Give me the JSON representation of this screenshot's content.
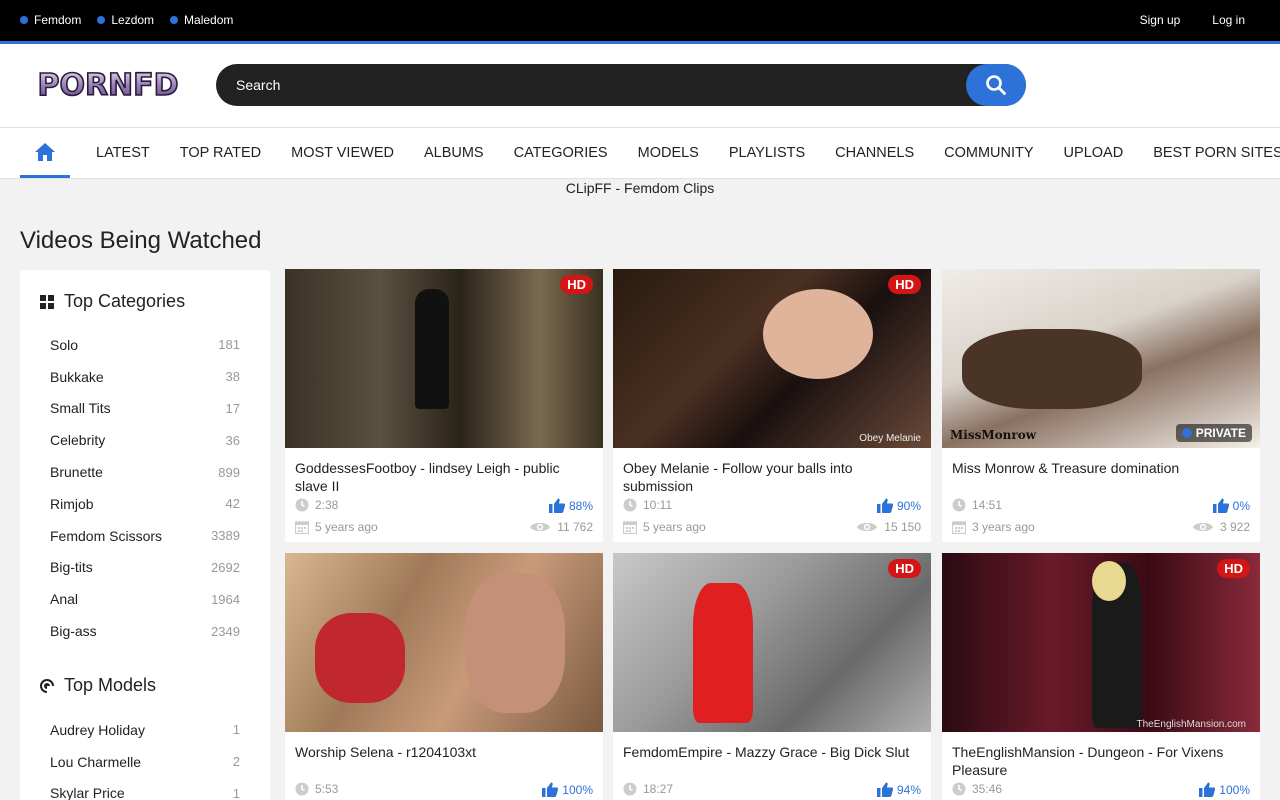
{
  "colors": {
    "accent": "#2d72d9",
    "hd_badge": "#d41515",
    "topbar": "#000000",
    "search_bg": "#222222"
  },
  "topbar": {
    "niches": [
      "Femdom",
      "Lezdom",
      "Maledom"
    ],
    "signup": "Sign up",
    "login": "Log in"
  },
  "header": {
    "logo_text": "PORNFD",
    "search_placeholder": "Search"
  },
  "nav": {
    "items": [
      "LATEST",
      "TOP RATED",
      "MOST VIEWED",
      "ALBUMS",
      "CATEGORIES",
      "MODELS",
      "PLAYLISTS",
      "CHANNELS",
      "COMMUNITY",
      "UPLOAD",
      "BEST PORN SITES"
    ]
  },
  "banner_text": "CLipFF - Femdom Clips",
  "page_title": "Videos Being Watched",
  "sidebar": {
    "categories_title": "Top Categories",
    "categories": [
      {
        "name": "Solo",
        "count": "181"
      },
      {
        "name": "Bukkake",
        "count": "38"
      },
      {
        "name": "Small Tits",
        "count": "17"
      },
      {
        "name": "Celebrity",
        "count": "36"
      },
      {
        "name": "Brunette",
        "count": "899"
      },
      {
        "name": "Rimjob",
        "count": "42"
      },
      {
        "name": "Femdom Scissors",
        "count": "3389"
      },
      {
        "name": "Big-tits",
        "count": "2692"
      },
      {
        "name": "Anal",
        "count": "1964"
      },
      {
        "name": "Big-ass",
        "count": "2349"
      }
    ],
    "models_title": "Top Models",
    "models": [
      {
        "name": "Audrey Holiday",
        "count": "1"
      },
      {
        "name": "Lou Charmelle",
        "count": "2"
      },
      {
        "name": "Skylar Price",
        "count": "1"
      }
    ]
  },
  "videos": [
    {
      "title": "GoddessesFootboy - lindsey Leigh - public slave II",
      "duration": "2:38",
      "rating": "88%",
      "age": "5 years ago",
      "views": "11 762",
      "badge": "HD"
    },
    {
      "title": "Obey Melanie - Follow your balls into submission",
      "duration": "10:11",
      "rating": "90%",
      "age": "5 years ago",
      "views": "15 150",
      "badge": "HD",
      "watermark": "Obey Melanie"
    },
    {
      "title": "Miss Monrow & Treasure domination",
      "duration": "14:51",
      "rating": "0%",
      "age": "3 years ago",
      "views": "3 922",
      "badge": "PRIVATE",
      "watermark": "MissMonrow"
    },
    {
      "title": "Worship Selena - r1204103xt",
      "duration": "5:53",
      "rating": "100%",
      "badge": ""
    },
    {
      "title": "FemdomEmpire - Mazzy Grace - Big Dick Slut",
      "duration": "18:27",
      "rating": "94%",
      "badge": "HD"
    },
    {
      "title": "TheEnglishMansion - Dungeon - For Vixens Pleasure",
      "duration": "35:46",
      "rating": "100%",
      "badge": "HD",
      "watermark": "TheEnglishMansion.com"
    }
  ]
}
